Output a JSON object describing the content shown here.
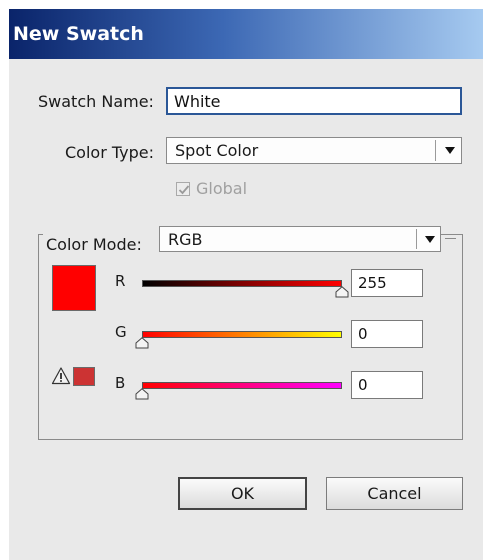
{
  "dialog": {
    "title": "New Swatch"
  },
  "swatch_name": {
    "label": "Swatch Name:",
    "value": "White"
  },
  "color_type": {
    "label": "Color Type:",
    "selected": "Spot Color"
  },
  "global_checkbox": {
    "label": "Global",
    "checked": true,
    "enabled": false
  },
  "color_mode": {
    "label": "Color Mode:",
    "selected": "RGB"
  },
  "color_preview": {
    "color": "#ff0000",
    "out_of_gamut_color": "#cc3333",
    "warning_icon": "out-of-gamut-warning-icon"
  },
  "channels": [
    {
      "label": "R",
      "value": "255",
      "fraction": 1.0,
      "gradient": [
        "#000000",
        "#ff0000"
      ]
    },
    {
      "label": "G",
      "value": "0",
      "fraction": 0.0,
      "gradient": [
        "#ff0000",
        "#ffff00"
      ]
    },
    {
      "label": "B",
      "value": "0",
      "fraction": 0.0,
      "gradient": [
        "#ff0000",
        "#ff00ff"
      ]
    }
  ],
  "buttons": {
    "ok": "OK",
    "cancel": "Cancel"
  }
}
